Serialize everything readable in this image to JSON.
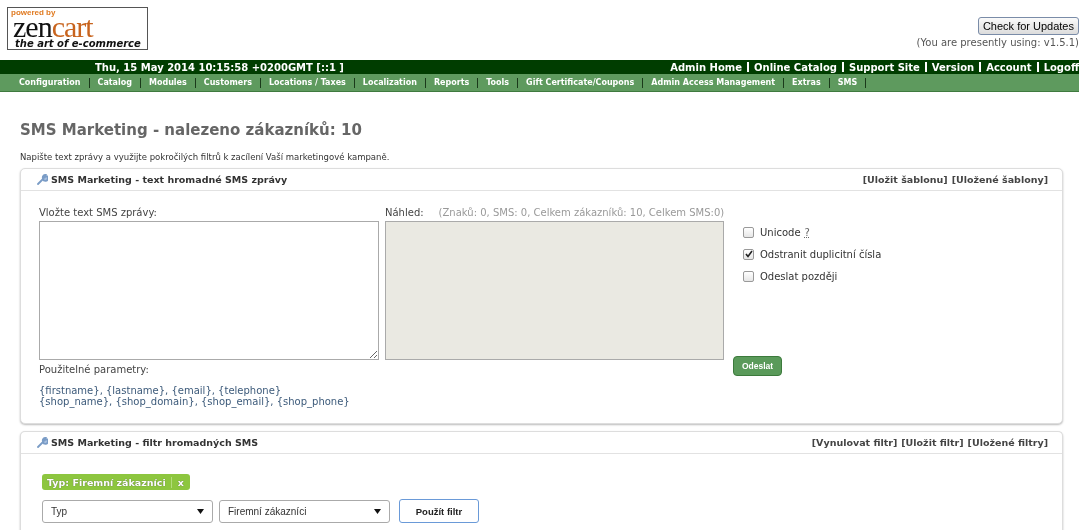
{
  "logo": {
    "powered": "powered by",
    "brand_a": "zen",
    "brand_b": "cart",
    "tagline": "the art of e-commerce"
  },
  "update": {
    "button": "Check for Updates",
    "version": "(You are presently using: v1.5.1)"
  },
  "header_bar": {
    "datetime": "Thu, 15 May 2014 10:15:58 +0200GMT [::1 ]",
    "links": [
      "Admin Home",
      "Online Catalog",
      "Support Site",
      "Version",
      "Account",
      "Logoff"
    ]
  },
  "menu": [
    "Configuration",
    "Catalog",
    "Modules",
    "Customers",
    "Locations / Taxes",
    "Localization",
    "Reports",
    "Tools",
    "Gift Certificate/Coupons",
    "Admin Access Management",
    "Extras",
    "SMS"
  ],
  "page_title": "SMS Marketing - nalezeno zákazníků: 10",
  "intro": "Napište text zprávy a využijte pokročilých filtrů k zacílení Vaší marketingové kampaně.",
  "message_panel": {
    "title": "SMS Marketing - text hromadné SMS zprávy",
    "actions": [
      "[Uložit šablonu]",
      "[Uložené šablony]"
    ],
    "message_label": "Vložte text SMS zprávy:",
    "preview_label": "Náhled:",
    "preview_stats": "(Znaků: 0, SMS: 0, Celkem zákazníků: 10, Celkem SMS:0)",
    "options": [
      {
        "label": "Unicode",
        "help": "?",
        "checked": false
      },
      {
        "label": "Odstranit duplicitní čísla",
        "checked": true
      },
      {
        "label": "Odeslat později",
        "checked": false
      }
    ],
    "send_button": "Odeslat",
    "params_label": "Použitelné parametry:",
    "params": [
      "{firstname}, {lastname}, {email}, {telephone}",
      "{shop_name}, {shop_domain}, {shop_email}, {shop_phone}"
    ]
  },
  "filter_panel": {
    "title": "SMS Marketing - filtr hromadných SMS",
    "actions": [
      "[Vynulovat filtr]",
      "[Uložit filtr]",
      "[Uložené filtry]"
    ],
    "tag": {
      "label": "Typ: Firemní zákazníci",
      "remove": "x"
    },
    "selects": [
      {
        "value": "Typ"
      },
      {
        "value": "Firemní zákazníci"
      }
    ],
    "apply_button": "Použít filtr"
  }
}
